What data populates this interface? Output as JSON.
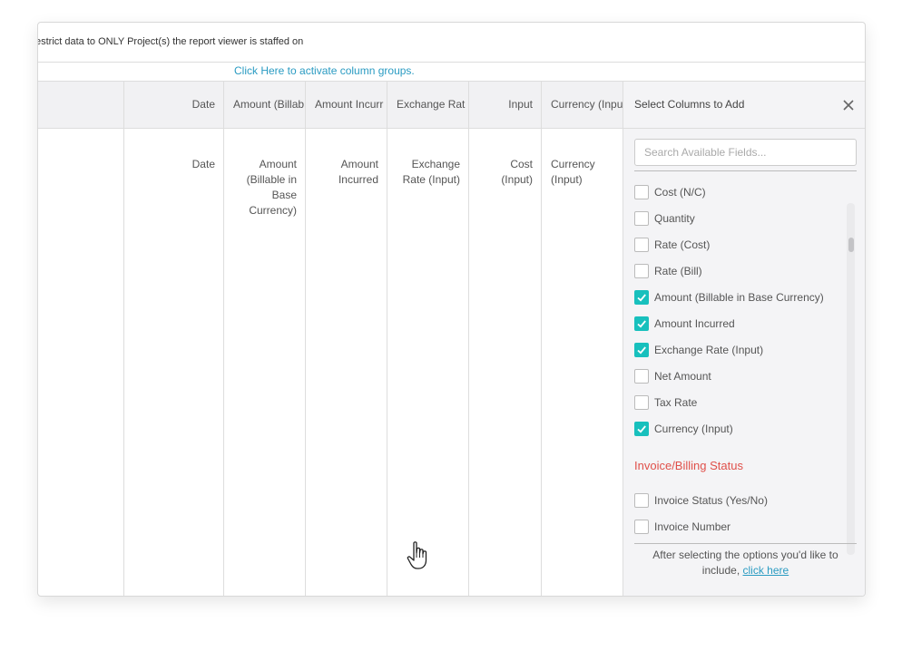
{
  "restrict_text": "estrict data to ONLY Project(s) the report viewer is staffed on",
  "groups_link": "Click Here to activate column groups.",
  "columns": [
    {
      "header": "Date",
      "body": "Date"
    },
    {
      "header": "Amount (Billab",
      "body": "Amount (Billable in Base Currency)"
    },
    {
      "header": "Amount Incurr",
      "body": "Amount Incurred"
    },
    {
      "header": "Exchange Rat",
      "body": "Exchange Rate (Input)"
    },
    {
      "header": "Input",
      "body": "Cost (Input)"
    },
    {
      "header": "Currency (Inpu",
      "body": "Currency (Input)"
    }
  ],
  "panel": {
    "title": "Select Columns to Add",
    "search_placeholder": "Search Available Fields...",
    "items": [
      {
        "label": "Cost (N/C)",
        "checked": false
      },
      {
        "label": "Quantity",
        "checked": false
      },
      {
        "label": "Rate (Cost)",
        "checked": false
      },
      {
        "label": "Rate (Bill)",
        "checked": false
      },
      {
        "label": "Amount (Billable in Base Currency)",
        "checked": true
      },
      {
        "label": "Amount Incurred",
        "checked": true
      },
      {
        "label": "Exchange Rate (Input)",
        "checked": true
      },
      {
        "label": "Net Amount",
        "checked": false
      },
      {
        "label": "Tax Rate",
        "checked": false
      },
      {
        "label": "Currency (Input)",
        "checked": true
      }
    ],
    "section_title": "Invoice/Billing Status",
    "section_items": [
      {
        "label": "Invoice Status (Yes/No)",
        "checked": false
      },
      {
        "label": "Invoice Number",
        "checked": false
      }
    ],
    "footer_text": "After selecting the options you'd like to include,",
    "footer_link": "click here"
  },
  "colors": {
    "accent": "#18c0bd",
    "link": "#2a9bc2",
    "section": "#e0504a"
  }
}
